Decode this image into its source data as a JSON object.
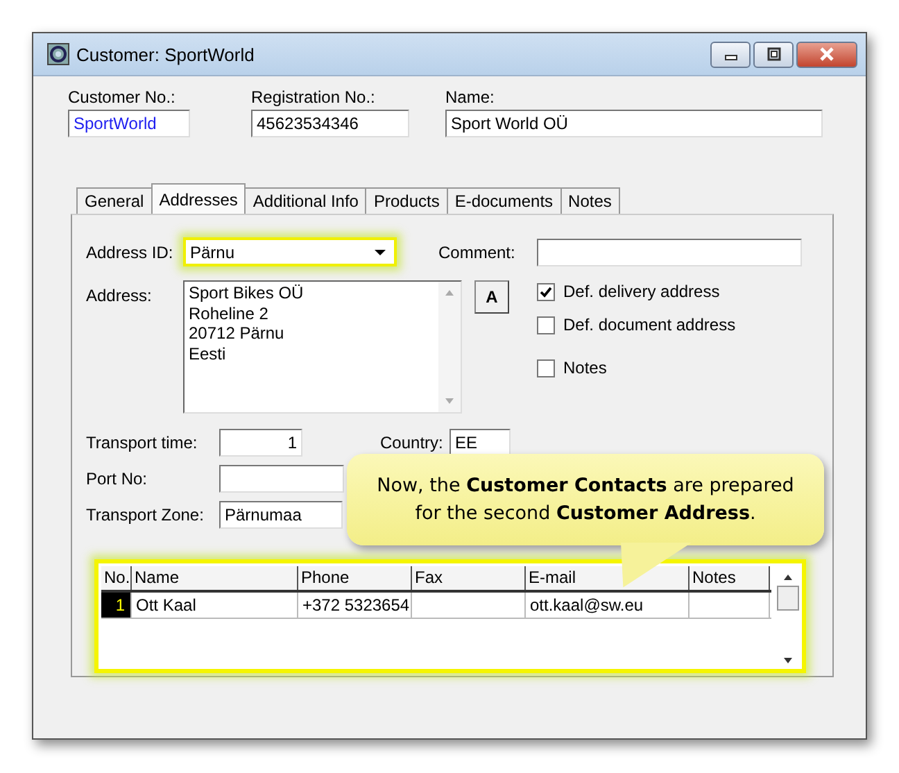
{
  "window": {
    "title": "Customer: SportWorld"
  },
  "header_fields": [
    {
      "label": "Customer No.:",
      "value": "SportWorld",
      "linked": true
    },
    {
      "label": "Registration No.:",
      "value": "45623534346",
      "linked": false
    },
    {
      "label": "Name:",
      "value": "Sport World OÜ",
      "linked": false
    }
  ],
  "tabs": [
    {
      "label": "General",
      "selected": false
    },
    {
      "label": "Addresses",
      "selected": true
    },
    {
      "label": "Additional Info",
      "selected": false
    },
    {
      "label": "Products",
      "selected": false
    },
    {
      "label": "E-documents",
      "selected": false
    },
    {
      "label": "Notes",
      "selected": false
    }
  ],
  "address_id": {
    "label": "Address ID:",
    "value": "Pärnu",
    "highlighted": true
  },
  "comment": {
    "label": "Comment:"
  },
  "address": {
    "label": "Address:",
    "lines": [
      "Sport Bikes OÜ",
      "Roheline 2",
      "20712 Pärnu",
      "Eesti"
    ]
  },
  "format_button": "A",
  "checkboxes": [
    {
      "label": "Def. delivery address",
      "checked": true
    },
    {
      "label": "Def. document address",
      "checked": false
    },
    {
      "label": "Notes",
      "checked": false
    }
  ],
  "transport_time": {
    "label": "Transport time:",
    "value": "1"
  },
  "country": {
    "label": "Country:",
    "value": "EE"
  },
  "port_no": {
    "label": "Port No:"
  },
  "transport_zone": {
    "label": "Transport Zone:",
    "value": "Pärnumaa"
  },
  "contacts": {
    "highlighted": true,
    "columns": [
      "No.",
      "Name",
      "Phone",
      "Fax",
      "E-mail",
      "Notes"
    ],
    "rows": [
      {
        "cells": [
          "1",
          "Ott Kaal",
          "+372 5323654",
          "",
          "ott.kaal@sw.eu",
          ""
        ],
        "current": true
      }
    ]
  },
  "callout": {
    "text": "Now, the **Customer Contacts** are prepared for the second **Customer Address**."
  }
}
